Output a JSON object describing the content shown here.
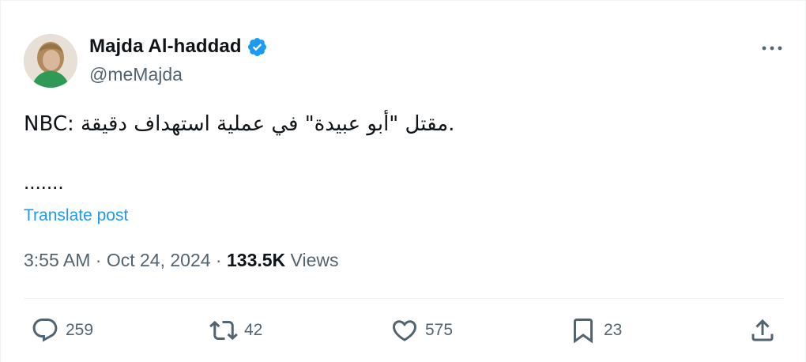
{
  "author": {
    "name": "Majda Al-haddad",
    "handle": "@meMajda",
    "verified_color": "#1d9bf0"
  },
  "tweet": {
    "text": "NBC: مقتل \"أبو عبيدة\" في عملية استهداف دقيقة.",
    "continuation": ".......",
    "translate_label": "Translate post"
  },
  "meta": {
    "time": "3:55 AM",
    "separator1": " · ",
    "date": "Oct 24, 2024",
    "separator2": " · ",
    "views_count": "133.5K",
    "views_label": " Views"
  },
  "actions": {
    "replies": "259",
    "reposts": "42",
    "likes": "575",
    "bookmarks": "23"
  },
  "icons": {
    "verified": "verified-badge-icon",
    "more": "more-options-icon",
    "reply": "reply-icon",
    "repost": "repost-icon",
    "like": "heart-icon",
    "bookmark": "bookmark-icon",
    "share": "share-icon"
  },
  "colors": {
    "text": "#0f1419",
    "secondary": "#536471",
    "accent": "#1d9bf0",
    "divider": "#eff3f4"
  }
}
